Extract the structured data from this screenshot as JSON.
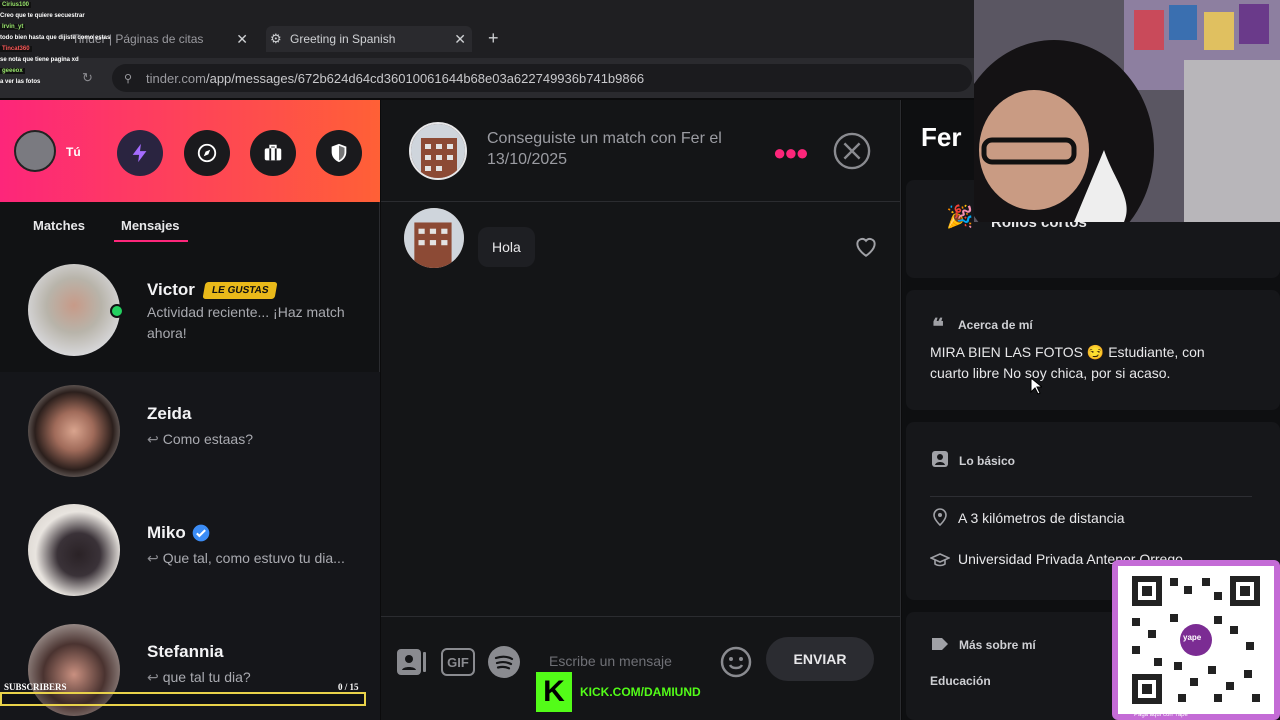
{
  "browser": {
    "tabs": [
      {
        "label": "Tinder | Páginas de citas"
      },
      {
        "label": "Greeting in Spanish"
      }
    ],
    "url_host": "tinder.com",
    "url_path": "/app/messages/672b624d64cd36010061644b68e03a622749936b741b9866"
  },
  "chat_overlay": [
    {
      "user": "Cirius100",
      "text": "Creo que te quiere secuestrar"
    },
    {
      "user": "Irvin_yt",
      "text": "todo bien hasta que dijiste como estas"
    },
    {
      "user": "Tincat360",
      "text": "se nota que tiene pagina xd"
    },
    {
      "user": "geeeox",
      "text": "a ver las fotos"
    }
  ],
  "sidebar": {
    "self_label": "Tú",
    "tabs": [
      "Matches",
      "Mensajes"
    ],
    "messages": [
      {
        "name": "Victor",
        "badge": "LE GUSTAS",
        "preview": "Actividad reciente... ¡Haz match ahora!"
      },
      {
        "name": "Zeida",
        "preview": "Como estaas?"
      },
      {
        "name": "Miko",
        "preview": "Que tal, como estuvo tu dia..."
      },
      {
        "name": "Stefannia",
        "preview": "que tal tu dia?"
      }
    ]
  },
  "conversation": {
    "title": "Conseguiste un match con Fer el 13/10/2025",
    "messages": [
      {
        "text": "Hola"
      }
    ],
    "input_placeholder": "Escribe un mensaje",
    "send_label": "ENVIAR",
    "gif_label": "GIF"
  },
  "profile": {
    "name": "Fer",
    "looking_for": "Rollos cortos",
    "about_title": "Acerca de mí",
    "about_text": "MIRA BIEN LAS FOTOS 😏 Estudiante, con cuarto libre No soy chica, por si acaso.",
    "basics_title": "Lo básico",
    "distance": "A 3 kilómetros de distancia",
    "university": "Universidad Privada Antenor Orrego",
    "more_title": "Más sobre mí",
    "education_label": "Educación"
  },
  "stream": {
    "subscribers_label": "SUBSCRIBERS",
    "subscribers_count": "0  / 15",
    "kick_text": "KICK.COM/DAMIUND",
    "qr_caption": "Paga aquí con Yape",
    "yape_label": "yape"
  },
  "colors": {
    "brand_gradient_start": "#fd267a",
    "brand_gradient_end": "#ff6036",
    "online": "#23d160",
    "badge": "#e9b91a",
    "kick": "#53fc18"
  }
}
